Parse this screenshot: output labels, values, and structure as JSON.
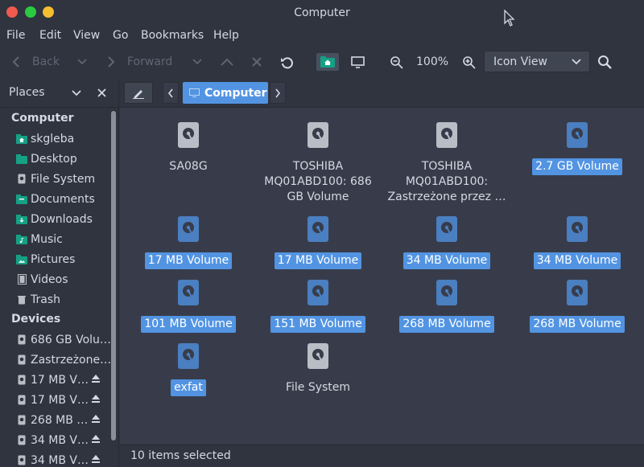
{
  "window": {
    "title": "Computer"
  },
  "menu": [
    "File",
    "Edit",
    "View",
    "Go",
    "Bookmarks",
    "Help"
  ],
  "toolbar": {
    "back_label": "Back",
    "forward_label": "Forward",
    "zoom_level": "100%",
    "view_mode": "Icon View"
  },
  "sidebar": {
    "header": "Places",
    "computer_heading": "Computer",
    "places": [
      {
        "label": "skgleba",
        "icon": "home-folder-icon"
      },
      {
        "label": "Desktop",
        "icon": "desktop-folder-icon"
      },
      {
        "label": "File System",
        "icon": "drive-icon"
      },
      {
        "label": "Documents",
        "icon": "folder-icon"
      },
      {
        "label": "Downloads",
        "icon": "folder-icon"
      },
      {
        "label": "Music",
        "icon": "folder-icon"
      },
      {
        "label": "Pictures",
        "icon": "folder-icon"
      },
      {
        "label": "Videos",
        "icon": "film-icon"
      },
      {
        "label": "Trash",
        "icon": "trash-icon"
      }
    ],
    "devices_heading": "Devices",
    "devices": [
      {
        "label": "686 GB Volu…",
        "eject": false
      },
      {
        "label": "Zastrzeżone…",
        "eject": false
      },
      {
        "label": "17 MB V…",
        "eject": true
      },
      {
        "label": "17 MB V…",
        "eject": true
      },
      {
        "label": "268 MB …",
        "eject": true
      },
      {
        "label": "34 MB V…",
        "eject": true
      },
      {
        "label": "34 MB V…",
        "eject": true
      }
    ]
  },
  "pathbar": {
    "current": "Computer"
  },
  "items": [
    {
      "label": "SA08G",
      "selected": false
    },
    {
      "label": "TOSHIBA MQ01ABD100: 686 GB Volume",
      "lines": [
        "TOSHIBA",
        "MQ01ABD100: 686",
        "GB Volume"
      ],
      "selected": false
    },
    {
      "label": "TOSHIBA MQ01ABD100: Zastrzeżone przez …",
      "lines": [
        "TOSHIBA",
        "MQ01ABD100:",
        "Zastrzeżone przez …"
      ],
      "selected": false
    },
    {
      "label": "2.7 GB Volume",
      "selected": true
    },
    {
      "label": "17 MB Volume",
      "selected": true
    },
    {
      "label": "17 MB Volume",
      "selected": true
    },
    {
      "label": "34 MB Volume",
      "selected": true
    },
    {
      "label": "34 MB Volume",
      "selected": true
    },
    {
      "label": "101 MB Volume",
      "selected": true
    },
    {
      "label": "151 MB Volume",
      "selected": true
    },
    {
      "label": "268 MB Volume",
      "selected": true
    },
    {
      "label": "268 MB Volume",
      "selected": true
    },
    {
      "label": "exfat",
      "selected": true
    },
    {
      "label": "File System",
      "selected": false
    }
  ],
  "status": {
    "text": "10 items selected"
  },
  "colors": {
    "accent": "#5294e2",
    "bg": "#383c4a",
    "chrome": "#2f343f",
    "folder_green": "#16a085"
  }
}
